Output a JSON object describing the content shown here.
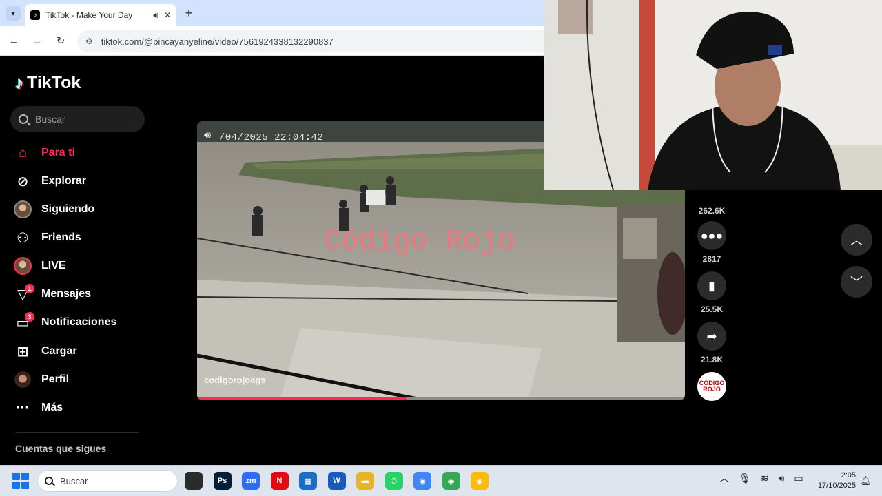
{
  "browser": {
    "tab_title": "TikTok - Make Your Day",
    "url": "tiktok.com/@pincayanyeline/video/7561924338132290837"
  },
  "sidebar": {
    "logo_text": "TikTok",
    "search_placeholder": "Buscar",
    "items": [
      {
        "label": "Para ti",
        "icon": "home-icon",
        "active": true
      },
      {
        "label": "Explorar",
        "icon": "compass-icon"
      },
      {
        "label": "Siguiendo",
        "icon": "avatar"
      },
      {
        "label": "Friends",
        "icon": "friends-icon"
      },
      {
        "label": "LIVE",
        "icon": "live-avatar"
      },
      {
        "label": "Mensajes",
        "icon": "messages-icon",
        "badge": "1"
      },
      {
        "label": "Notificaciones",
        "icon": "notifications-icon",
        "badge": "3"
      },
      {
        "label": "Cargar",
        "icon": "upload-icon"
      },
      {
        "label": "Perfil",
        "icon": "profile-avatar"
      },
      {
        "label": "Más",
        "icon": "more-icon"
      }
    ],
    "following_title": "Cuentas que sigues"
  },
  "video": {
    "timestamp": "/04/2025 22:04:42",
    "watermark": "Código Rojo",
    "author": "codigorojoags",
    "progress": 0.43
  },
  "actions": {
    "likes": "262.6K",
    "comments": "2817",
    "saves": "25.5K",
    "shares": "21.8K",
    "author_avatar_text": "CÓDIGO ROJO"
  },
  "taskbar": {
    "search_placeholder": "Buscar",
    "time": "2:05",
    "date": "17/10/2025",
    "apps": [
      {
        "name": "file-explorer",
        "label": "",
        "color": "#2b2b2b"
      },
      {
        "name": "photoshop",
        "label": "Ps",
        "color": "#001e36"
      },
      {
        "name": "zoom",
        "label": "zm",
        "color": "#2d6cf5"
      },
      {
        "name": "netflix",
        "label": "N",
        "color": "#e50914"
      },
      {
        "name": "store",
        "label": "▦",
        "color": "#1b6ec2"
      },
      {
        "name": "word",
        "label": "W",
        "color": "#185abd"
      },
      {
        "name": "folder",
        "label": "▬",
        "color": "#e8b32a"
      },
      {
        "name": "whatsapp",
        "label": "✆",
        "color": "#25d366"
      },
      {
        "name": "chrome-1",
        "label": "◉",
        "color": "#4285f4"
      },
      {
        "name": "chrome-2",
        "label": "◉",
        "color": "#34a853"
      },
      {
        "name": "chrome-3",
        "label": "◉",
        "color": "#fbbc05"
      }
    ]
  },
  "colors": {
    "accent": "#fe2c55",
    "background": "#000000"
  }
}
